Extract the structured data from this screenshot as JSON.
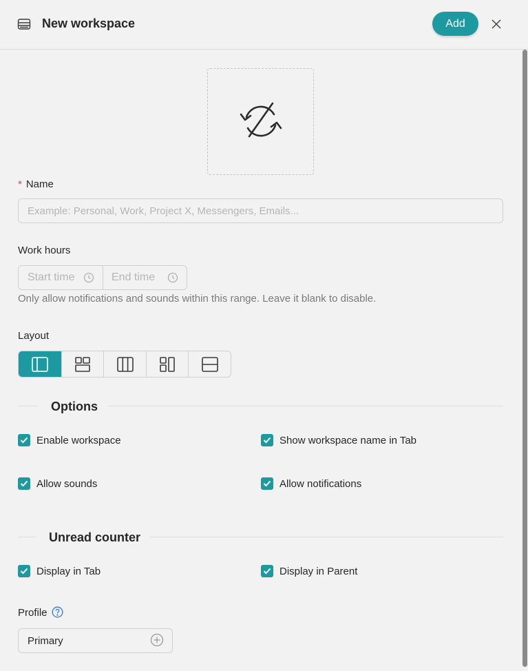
{
  "header": {
    "title": "New workspace",
    "add_label": "Add",
    "icon": "workspace-icon",
    "close_icon": "close-icon"
  },
  "icon_picker": {
    "icon": "sync-disabled-icon"
  },
  "name": {
    "required_mark": "*",
    "label": "Name",
    "value": "",
    "placeholder": "Example: Personal, Work, Project X, Messengers, Emails..."
  },
  "work_hours": {
    "label": "Work hours",
    "start_placeholder": "Start time",
    "end_placeholder": "End time",
    "helper": "Only allow notifications and sounds within this range. Leave it blank to disable."
  },
  "layout": {
    "label": "Layout",
    "selected_index": 0,
    "options": [
      {
        "icon": "layout-sidebar-icon"
      },
      {
        "icon": "layout-grid-icon"
      },
      {
        "icon": "layout-columns-icon"
      },
      {
        "icon": "layout-split-icon"
      },
      {
        "icon": "layout-rows-icon"
      }
    ]
  },
  "options": {
    "title": "Options",
    "items": [
      {
        "label": "Enable workspace",
        "checked": true
      },
      {
        "label": "Show workspace name in Tab",
        "checked": true
      },
      {
        "label": "Allow sounds",
        "checked": true
      },
      {
        "label": "Allow notifications",
        "checked": true
      }
    ]
  },
  "unread_counter": {
    "title": "Unread counter",
    "items": [
      {
        "label": "Display in Tab",
        "checked": true
      },
      {
        "label": "Display in Parent",
        "checked": true
      }
    ]
  },
  "profile": {
    "label": "Profile",
    "value": "Primary",
    "help_icon": "help-icon"
  },
  "colors": {
    "accent": "#1d9aa0",
    "background": "#f2f2f2",
    "required": "#e04b4b",
    "help": "#2f7fe0"
  }
}
